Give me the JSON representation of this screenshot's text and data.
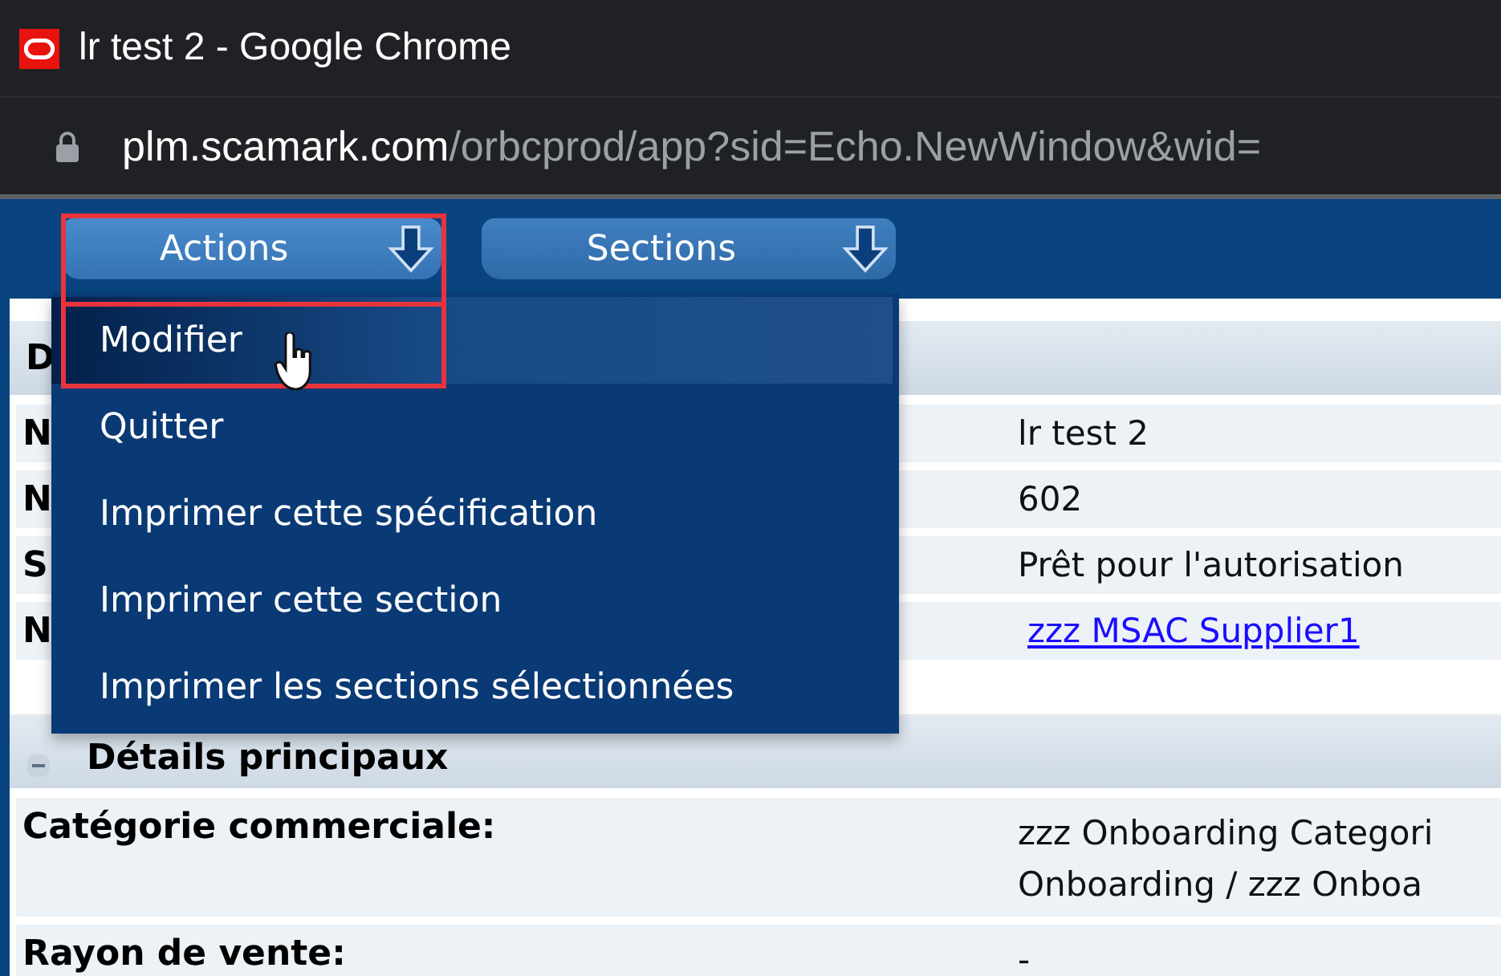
{
  "window": {
    "title": "lr test 2 - Google Chrome"
  },
  "address": {
    "host": "plm.scamark.com",
    "path": "/orbcprod/app?sid=Echo.NewWindow&wid="
  },
  "toolbar": [
    {
      "label": "Actions",
      "selected": true
    },
    {
      "label": "Sections",
      "selected": false
    }
  ],
  "menu": {
    "items": [
      {
        "label": "Modifier",
        "selected": true
      },
      {
        "label": "Quitter",
        "selected": false
      },
      {
        "label": "Imprimer cette spécification",
        "selected": false
      },
      {
        "label": "Imprimer cette section",
        "selected": false
      },
      {
        "label": "Imprimer les sections sélectionnées",
        "selected": false
      }
    ]
  },
  "summary": {
    "heading": "D",
    "rows": [
      {
        "label": "N",
        "value": "lr test 2",
        "kind": "text"
      },
      {
        "label": "N",
        "value": "602",
        "kind": "text"
      },
      {
        "label": "S",
        "value": "Prêt pour l'autorisation",
        "kind": "text"
      },
      {
        "label": "N",
        "value": "zzz MSAC Supplier1",
        "kind": "link"
      }
    ]
  },
  "section": {
    "title": "Détails principaux",
    "expanded": true,
    "rows": [
      {
        "label": "Catégorie commerciale:",
        "value_lines": [
          "zzz Onboarding Categori",
          "Onboarding / zzz Onboa"
        ]
      },
      {
        "label": "Rayon de vente:",
        "value_lines": [
          "-"
        ]
      }
    ]
  }
}
